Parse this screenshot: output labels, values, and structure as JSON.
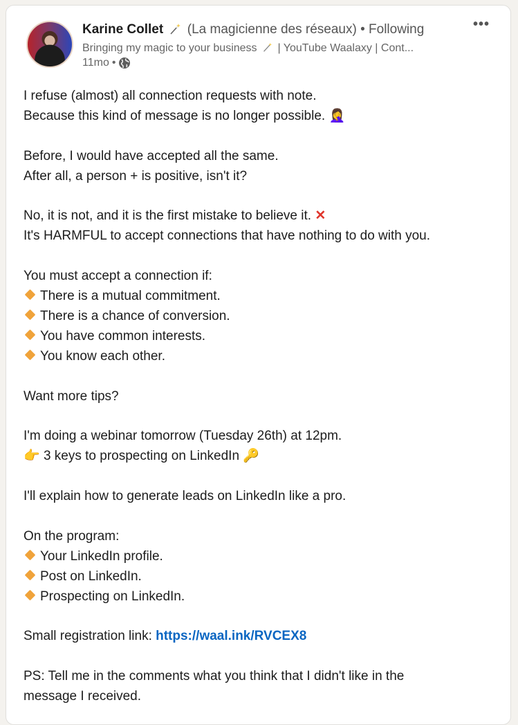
{
  "post": {
    "author": {
      "name": "Karine Collet",
      "name_suffix": "(La magicienne des réseaux)",
      "separator": "•",
      "follow_status": "Following",
      "headline_prefix": "Bringing my magic to your business",
      "headline_suffix": "| YouTube Waalaxy | Cont...",
      "time": "11mo",
      "time_separator": "•",
      "visibility_icon": "globe-icon",
      "avatar_icon": "avatar"
    },
    "more_icon": "•••",
    "lines": {
      "l1": "I refuse (almost) all connection requests with note.",
      "l2": "Because this kind of message is no longer possible.",
      "l2_emoji": "🤦‍♀️",
      "l3": "Before, I would have accepted all the same.",
      "l4": "After all, a person + is positive, isn't it?",
      "l5": "No, it is not, and it is the first mistake to believe it.",
      "l5_emoji": "✕",
      "l6": "It's HARMFUL to accept connections that have nothing to do with you.",
      "l7": "You must accept a connection if:",
      "criteria": [
        "There is a mutual commitment.",
        "There is a chance of conversion.",
        "You have common interests.",
        "You know each other."
      ],
      "l8": "Want more tips?",
      "l9": "I'm doing a webinar tomorrow (Tuesday 26th) at 12pm.",
      "l10_emoji_pre": "👉",
      "l10": "3 keys to prospecting on LinkedIn",
      "l10_emoji_post": "🔑",
      "l11": "I'll explain how to generate leads on LinkedIn like a pro.",
      "l12": "On the program:",
      "program": [
        "Your LinkedIn profile.",
        "Post on LinkedIn.",
        "Prospecting on LinkedIn."
      ],
      "l13_prefix": "Small registration link:",
      "l13_link": "https://waal.ink/RVCEX8",
      "l14": "PS: Tell me in the comments what you think that I didn't like in the",
      "l15": "message I received."
    },
    "colors": {
      "link": "#0a66c2",
      "bullet": "#f0a33a",
      "cross": "#e0352b"
    }
  }
}
